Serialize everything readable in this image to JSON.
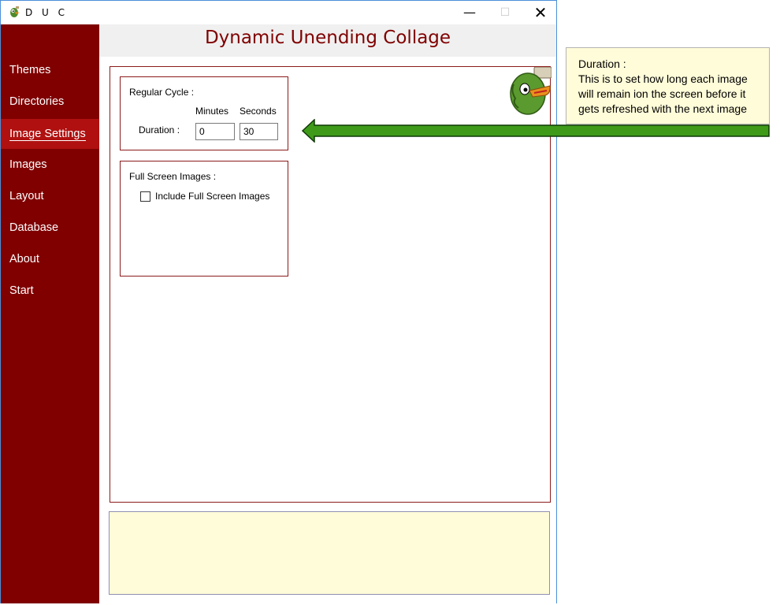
{
  "window": {
    "title": "D U C",
    "icon": "duck-app-icon"
  },
  "controls": {
    "minimize": "—",
    "maximize": "☐",
    "close": "✕"
  },
  "header": {
    "title": "Dynamic Unending Collage"
  },
  "sidebar": {
    "items": [
      {
        "label": "Themes"
      },
      {
        "label": "Directories"
      },
      {
        "label": "Image Settings",
        "active": true
      },
      {
        "label": "Images"
      },
      {
        "label": "Layout"
      },
      {
        "label": "Database"
      },
      {
        "label": "About"
      },
      {
        "label": "Start"
      }
    ]
  },
  "regular_cycle": {
    "title": "Regular Cycle :",
    "minutes_header": "Minutes",
    "seconds_header": "Seconds",
    "duration_label": "Duration :",
    "minutes_value": "0",
    "seconds_value": "30"
  },
  "full_screen": {
    "title": "Full Screen Images :",
    "checkbox_label": "Include Full Screen Images",
    "checked": false
  },
  "callout": {
    "title": "Duration :",
    "body": "This is to set how long each image\nwill remain ion the screen before it\ngets refreshed with the next image"
  },
  "colors": {
    "sidebar": "#800000",
    "active_item": "#b01010",
    "heading": "#800000",
    "callout_bg": "#fffcd9",
    "arrow": "#3f9a1a"
  }
}
